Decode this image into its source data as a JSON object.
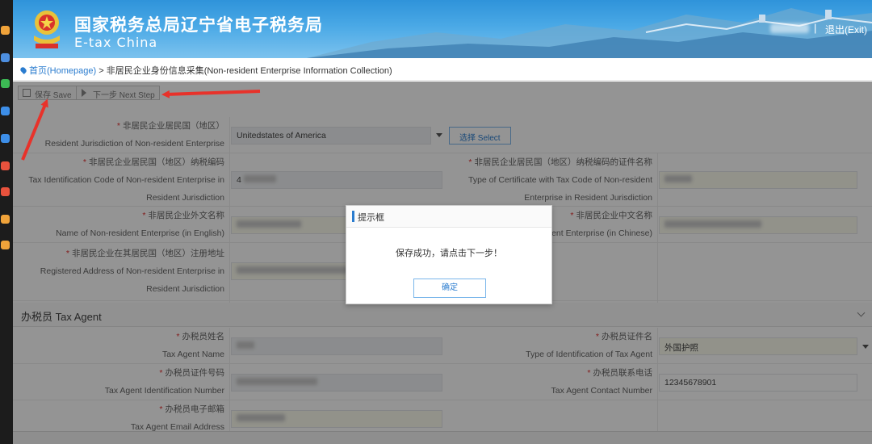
{
  "header": {
    "title_cn": "国家税务总局辽宁省电子税务局",
    "title_en": "E-tax China",
    "separator": "|",
    "exit_label": "退出(Exit)"
  },
  "breadcrumb": {
    "home": "首页(Homepage)",
    "sep": ">",
    "current": "非居民企业身份信息采集(Non-resident Enterprise Information Collection)"
  },
  "toolbar": {
    "save_label": "保存 Save",
    "next_label": "下一步 Next Step"
  },
  "form": {
    "jurisdiction": {
      "label_cn": "非居民企业居民国（地区）",
      "label_en": "Resident Jurisdiction of Non-resident Enterprise",
      "value": "Unitedstates of America",
      "select_label": "选择 Select"
    },
    "tax_code": {
      "label_cn": "非居民企业居民国（地区）纳税编码",
      "label_en_1": "Tax Identification Code of Non-resident Enterprise in",
      "label_en_2": "Resident Jurisdiction",
      "value_prefix": "4"
    },
    "cert_type": {
      "label_cn": "非居民企业居民国（地区）纳税编码的证件名称",
      "label_en_1": "Type of Certificate with Tax Code of Non-resident",
      "label_en_2": "Enterprise in Resident Jurisdiction"
    },
    "name_en": {
      "label_cn": "非居民企业外文名称",
      "label_en": "Name of Non-resident Enterprise (in English)"
    },
    "name_cn": {
      "label_cn": "非居民企业中文名称",
      "label_en": "ent Enterprise (in Chinese)"
    },
    "address": {
      "label_cn": "非居民企业在其居民国（地区）注册地址",
      "label_en_1": "Registered Address of Non-resident Enterprise in",
      "label_en_2": "Resident Jurisdiction"
    }
  },
  "agent": {
    "section_title": "办税员 Tax Agent",
    "name": {
      "label_cn": "办税员姓名",
      "label_en": "Tax Agent Name"
    },
    "id_type": {
      "label_cn": "办税员证件名",
      "label_en": "Type of Identification of Tax Agent",
      "value": "外国护照"
    },
    "id_number": {
      "label_cn": "办税员证件号码",
      "label_en": "Tax Agent Identification Number"
    },
    "phone": {
      "label_cn": "办税员联系电话",
      "label_en": "Tax Agent Contact Number",
      "value": "12345678901"
    },
    "email": {
      "label_cn": "办税员电子邮箱",
      "label_en": "Tax Agent Email Address"
    }
  },
  "dialog": {
    "title": "提示框",
    "message": "保存成功，请点击下一步！",
    "ok_label": "确定"
  },
  "colors": {
    "header_blue": "#2f93da",
    "accent": "#2a7ccf",
    "required": "#e03030",
    "annotation_arrow": "#e8322a"
  },
  "icons": [
    "location-pin-icon",
    "save-icon",
    "next-arrow-icon",
    "dropdown-arrow-icon",
    "chevron-down-icon",
    "tax-emblem-icon"
  ]
}
